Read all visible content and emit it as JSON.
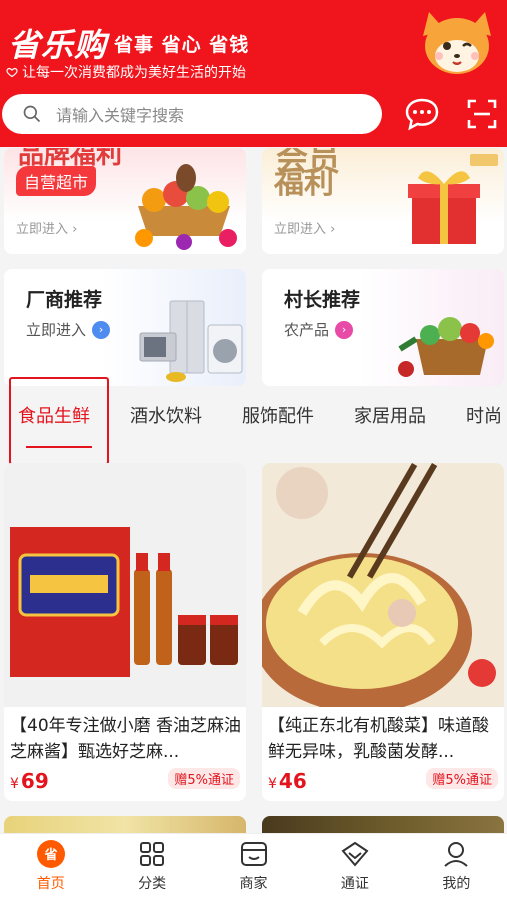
{
  "header": {
    "brand": "省乐购",
    "slogan": "省事 省心 省钱",
    "subslogan": "让每一次消费都成为美好生活的开始",
    "search_placeholder": "请输入关键字搜索"
  },
  "promos_top": [
    {
      "heading": "品牌福利",
      "tag": "自营超市",
      "link": "立即进入 ›"
    },
    {
      "heading_line1": "会员",
      "heading_line2": "福利",
      "link": "立即进入 ›"
    }
  ],
  "promos": [
    {
      "title": "厂商推荐",
      "subtitle": "立即进入",
      "arrow_color": "#4e8cf0"
    },
    {
      "title": "村长推荐",
      "subtitle": "农产品",
      "arrow_color": "#e84aa8"
    }
  ],
  "tabs": [
    "食品生鲜",
    "酒水饮料",
    "服饰配件",
    "家居用品",
    "时尚"
  ],
  "active_tab": "食品生鲜",
  "products": [
    {
      "title": "【40年专注做小磨 香油芝麻油芝麻酱】甄选好芝麻...",
      "currency": "¥",
      "price": "69",
      "bonus": "赠5%通证"
    },
    {
      "title": "【纯正东北有机酸菜】味道酸鲜无异味，乳酸菌发酵...",
      "currency": "¥",
      "price": "46",
      "bonus": "赠5%通证"
    }
  ],
  "bottom_nav": [
    {
      "label": "首页",
      "icon": "home-icon",
      "active": true
    },
    {
      "label": "分类",
      "icon": "category-icon",
      "active": false
    },
    {
      "label": "商家",
      "icon": "store-icon",
      "active": false
    },
    {
      "label": "通证",
      "icon": "token-icon",
      "active": false
    },
    {
      "label": "我的",
      "icon": "profile-icon",
      "active": false
    }
  ],
  "colors": {
    "brand_red": "#f0141c",
    "accent_orange": "#ff5a00",
    "price_red": "#e3141d"
  }
}
